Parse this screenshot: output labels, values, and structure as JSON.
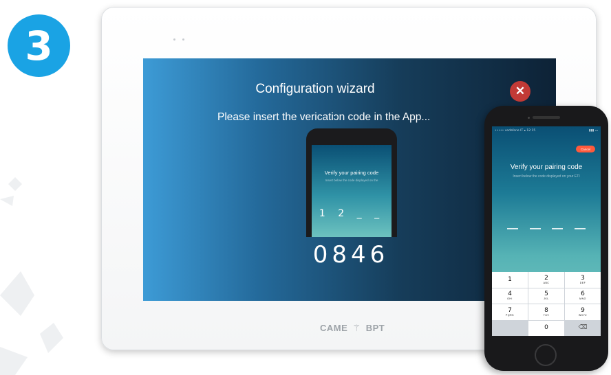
{
  "step": {
    "number": "3",
    "color": "#1aa3e4"
  },
  "tablet": {
    "brand": {
      "left": "CAME",
      "right": "BPT",
      "icon": "came-logo-icon"
    },
    "screen": {
      "title": "Configuration wizard",
      "message": "Please insert the vericatiɔn code in the App...",
      "close_icon": "close-icon",
      "verification_code": "0846",
      "mini_phone": {
        "title": "Verify your pairing code",
        "subtitle": "Insert below the code displayed on the",
        "partial_code": "1 2 _ _"
      }
    }
  },
  "phone": {
    "status": {
      "carrier": "••••• vodafone IT  ▴  12:15",
      "battery": "▮▮▮ ▭"
    },
    "cancel_label": "Cancel",
    "title": "Verify your pairing code",
    "subtitle": "Insert below the code displayed on your ETI",
    "keypad": [
      {
        "digit": "1",
        "letters": ""
      },
      {
        "digit": "2",
        "letters": "ABC"
      },
      {
        "digit": "3",
        "letters": "DEF"
      },
      {
        "digit": "4",
        "letters": "GHI"
      },
      {
        "digit": "5",
        "letters": "JKL"
      },
      {
        "digit": "6",
        "letters": "MNO"
      },
      {
        "digit": "7",
        "letters": "PQRS"
      },
      {
        "digit": "8",
        "letters": "TUV"
      },
      {
        "digit": "9",
        "letters": "WXYZ"
      },
      {
        "digit": "",
        "letters": ""
      },
      {
        "digit": "0",
        "letters": ""
      },
      {
        "digit": "⌫",
        "letters": ""
      }
    ]
  }
}
